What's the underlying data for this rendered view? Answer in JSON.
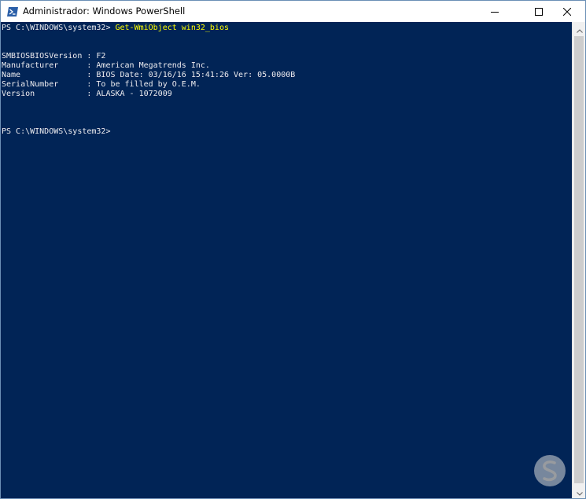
{
  "window": {
    "title": "Administrador: Windows PowerShell",
    "colors": {
      "console_bg": "#012456",
      "console_text": "#eeedf0",
      "command_text": "#ffff00",
      "titlebar_bg": "#ffffff"
    }
  },
  "titlebar": {
    "app_icon": "powershell-icon",
    "buttons": [
      {
        "name": "minimize",
        "icon": "minimize-icon"
      },
      {
        "name": "maximize",
        "icon": "maximize-icon"
      },
      {
        "name": "close",
        "icon": "close-icon"
      }
    ]
  },
  "console": {
    "prompt1": "PS C:\\WINDOWS\\system32> ",
    "command1": "Get-WmiObject win32_bios",
    "output": [
      "SMBIOSBIOSVersion : F2",
      "Manufacturer      : American Megatrends Inc.",
      "Name              : BIOS Date: 03/16/16 15:41:26 Ver: 05.0000B",
      "SerialNumber      : To be filled by O.E.M.",
      "Version           : ALASKA - 1072009"
    ],
    "prompt2": "PS C:\\WINDOWS\\system32>"
  },
  "scrollbar": {
    "up_icon": "chevron-up-icon",
    "down_icon": "chevron-down-icon"
  },
  "watermark": {
    "logo": "solvetic-logo"
  }
}
